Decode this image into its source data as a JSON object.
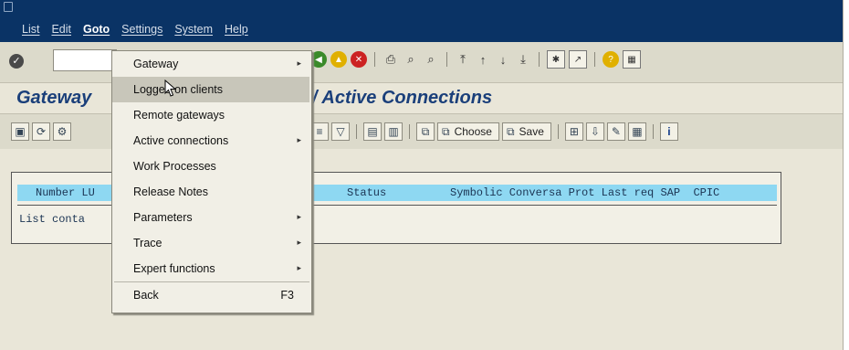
{
  "menubar": {
    "items": [
      "List",
      "Edit",
      "Goto",
      "Settings",
      "System",
      "Help"
    ],
    "active": "Goto"
  },
  "title": {
    "left": "Gateway",
    "right": "/ Active Connections"
  },
  "toolbar2": {
    "choose_label": "Choose",
    "save_label": "Save"
  },
  "list": {
    "header_num": "Number LU",
    "header_status": "Status",
    "header_rest": "Symbolic Conversa Prot Last req SAP  CPIC",
    "message": "List conta"
  },
  "goto_menu": {
    "items": [
      {
        "label": "Gateway",
        "submenu": true
      },
      {
        "label": "Logged on clients",
        "submenu": false,
        "highlighted": true
      },
      {
        "label": "Remote gateways",
        "submenu": false
      },
      {
        "label": "Active connections",
        "submenu": true
      },
      {
        "label": "Work Processes",
        "submenu": false
      },
      {
        "label": "Release Notes",
        "submenu": false
      },
      {
        "label": "Parameters",
        "submenu": true
      },
      {
        "label": "Trace",
        "submenu": true
      },
      {
        "label": "Expert functions",
        "submenu": true
      },
      {
        "label": "Back",
        "shortcut": "F3"
      }
    ]
  },
  "colors": {
    "titlebar": "#0a3365",
    "list_header": "#8ed8f2",
    "title_text": "#1a3f7a"
  }
}
